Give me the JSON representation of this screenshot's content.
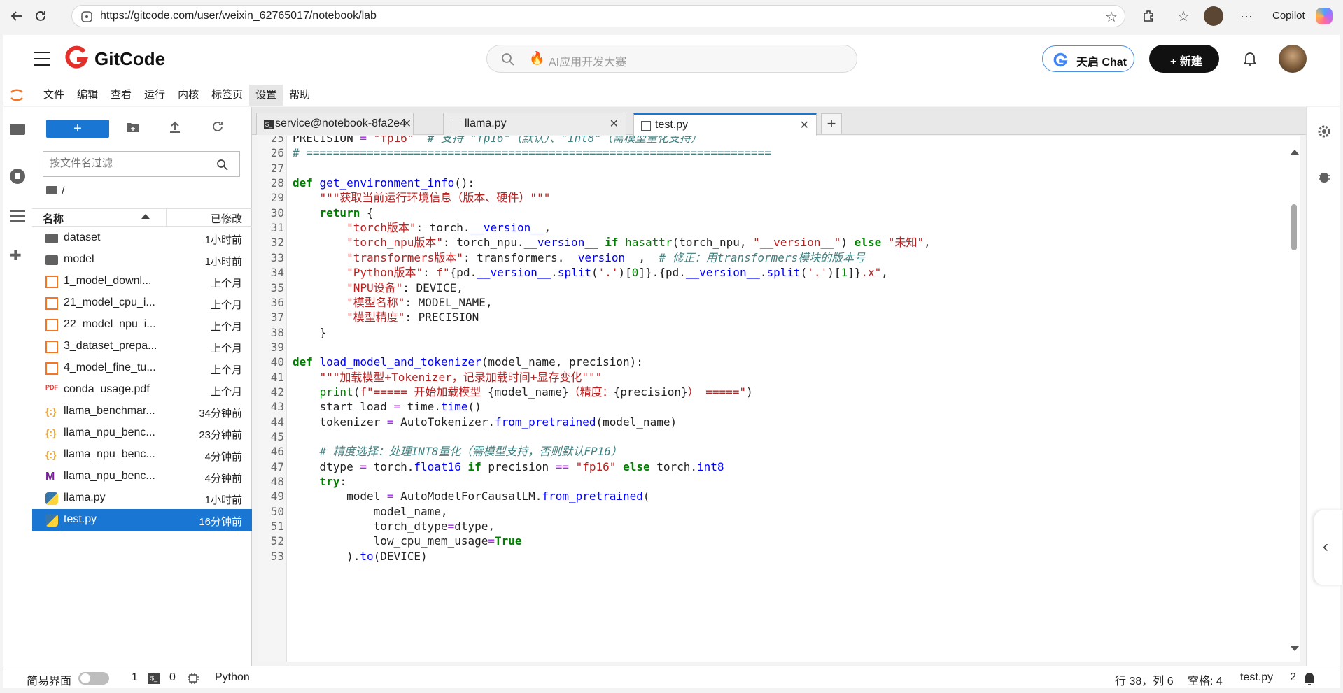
{
  "browser": {
    "url": "https://gitcode.com/user/weixin_62765017/notebook/lab",
    "copilot_label": "Copilot"
  },
  "site": {
    "logo_text": "GitCode",
    "search_placeholder": "AI应用开发大赛",
    "tianqi_label": "天启 Chat",
    "new_label": "+ 新建"
  },
  "menubar": {
    "items": [
      "文件",
      "编辑",
      "查看",
      "运行",
      "内核",
      "标签页",
      "设置",
      "帮助"
    ],
    "active_index": 6
  },
  "filebrowser": {
    "new_label": "+",
    "filter_placeholder": "按文件名过滤",
    "breadcrumb": "/",
    "col_name": "名称",
    "col_modified": "已修改",
    "files": [
      {
        "name": "dataset",
        "modified": "1小时前",
        "icon": "folder-icon",
        "selected": false
      },
      {
        "name": "model",
        "modified": "1小时前",
        "icon": "folder-icon",
        "selected": false
      },
      {
        "name": "1_model_downl...",
        "modified": "上个月",
        "icon": "notebook-icon",
        "selected": false
      },
      {
        "name": "21_model_cpu_i...",
        "modified": "上个月",
        "icon": "notebook-icon",
        "selected": false
      },
      {
        "name": "22_model_npu_i...",
        "modified": "上个月",
        "icon": "notebook-icon",
        "selected": false
      },
      {
        "name": "3_dataset_prepa...",
        "modified": "上个月",
        "icon": "notebook-icon",
        "selected": false
      },
      {
        "name": "4_model_fine_tu...",
        "modified": "上个月",
        "icon": "notebook-icon",
        "selected": false
      },
      {
        "name": "conda_usage.pdf",
        "modified": "上个月",
        "icon": "pdf-icon",
        "selected": false
      },
      {
        "name": "llama_benchmar...",
        "modified": "34分钟前",
        "icon": "json-icon",
        "selected": false
      },
      {
        "name": "llama_npu_benc...",
        "modified": "23分钟前",
        "icon": "json-icon",
        "selected": false
      },
      {
        "name": "llama_npu_benc...",
        "modified": "4分钟前",
        "icon": "json-icon",
        "selected": false
      },
      {
        "name": "llama_npu_benc...",
        "modified": "4分钟前",
        "icon": "markdown-icon",
        "selected": false
      },
      {
        "name": "llama.py",
        "modified": "1小时前",
        "icon": "python-icon",
        "selected": false
      },
      {
        "name": "test.py",
        "modified": "16分钟前",
        "icon": "python-icon",
        "selected": true
      }
    ]
  },
  "tabs": [
    {
      "label": "service@notebook-8fa2e4",
      "icon": "terminal-icon",
      "active": false
    },
    {
      "label": "llama.py",
      "icon": "file-icon",
      "active": false
    },
    {
      "label": "test.py",
      "icon": "file-icon",
      "active": true
    }
  ],
  "editor": {
    "lines": [
      {
        "n": "25",
        "html": "PRECISION <span class='op'>=</span> <span class='str'>\"fp16\"</span>  <span class='cmt'># 支持 \"fp16\"（默认）、\"int8\"（需模型量化支持）</span>"
      },
      {
        "n": "26",
        "html": "<span class='cmt'># =====================================================================</span>"
      },
      {
        "n": "27",
        "html": ""
      },
      {
        "n": "28",
        "html": "<span class='kw'>def</span> <span class='fn'>get_environment_info</span>():"
      },
      {
        "n": "29",
        "html": "    <span class='str'>\"\"\"获取当前运行环境信息（版本、硬件）\"\"\"</span>"
      },
      {
        "n": "30",
        "html": "    <span class='kw'>return</span> {"
      },
      {
        "n": "31",
        "html": "        <span class='str'>\"torch版本\"</span>: torch.<span class='fn'>__version__</span>,"
      },
      {
        "n": "32",
        "html": "        <span class='str'>\"torch_npu版本\"</span>: torch_npu.<span class='fn'>__version__</span> <span class='kw'>if</span> <span class='bi'>hasattr</span>(torch_npu, <span class='str'>\"__version__\"</span>) <span class='kw'>else</span> <span class='str'>\"未知\"</span>,"
      },
      {
        "n": "33",
        "html": "        <span class='str'>\"transformers版本\"</span>: transformers.<span class='fn'>__version__</span>,  <span class='cmt'># 修正：用transformers模块的版本号</span>"
      },
      {
        "n": "34",
        "html": "        <span class='str'>\"Python版本\"</span>: <span class='str'>f\"</span>{pd.<span class='fn'>__version__</span>.<span class='fn'>split</span>(<span class='str'>'.'</span>)[<span class='num'>0</span>]}.{pd.<span class='fn'>__version__</span>.<span class='fn'>split</span>(<span class='str'>'.'</span>)[<span class='num'>1</span>]}<span class='str'>.x\"</span>,"
      },
      {
        "n": "35",
        "html": "        <span class='str'>\"NPU设备\"</span>: DEVICE,"
      },
      {
        "n": "36",
        "html": "        <span class='str'>\"模型名称\"</span>: MODEL_NAME,"
      },
      {
        "n": "37",
        "html": "        <span class='str'>\"模型精度\"</span>: PRECISION"
      },
      {
        "n": "38",
        "html": "    }"
      },
      {
        "n": "39",
        "html": ""
      },
      {
        "n": "40",
        "html": "<span class='kw'>def</span> <span class='fn'>load_model_and_tokenizer</span>(model_name, precision):"
      },
      {
        "n": "41",
        "html": "    <span class='str'>\"\"\"加载模型+Tokenizer，记录加载时间+显存变化\"\"\"</span>"
      },
      {
        "n": "42",
        "html": "    <span class='bi'>print</span>(<span class='str'>f\"===== 开始加载模型 </span>{model_name}<span class='str'>（精度：</span>{precision}<span class='str'>） =====\"</span>)"
      },
      {
        "n": "43",
        "html": "    start_load <span class='op'>=</span> time.<span class='fn'>time</span>()"
      },
      {
        "n": "44",
        "html": "    tokenizer <span class='op'>=</span> AutoTokenizer.<span class='fn'>from_pretrained</span>(model_name)"
      },
      {
        "n": "45",
        "html": ""
      },
      {
        "n": "46",
        "html": "    <span class='cmt'># 精度选择：处理INT8量化（需模型支持，否则默认FP16）</span>"
      },
      {
        "n": "47",
        "html": "    dtype <span class='op'>=</span> torch.<span class='fn'>float16</span> <span class='kw'>if</span> precision <span class='op'>==</span> <span class='str'>\"fp16\"</span> <span class='kw'>else</span> torch.<span class='fn'>int8</span>"
      },
      {
        "n": "48",
        "html": "    <span class='kw'>try</span>:"
      },
      {
        "n": "49",
        "html": "        model <span class='op'>=</span> AutoModelForCausalLM.<span class='fn'>from_pretrained</span>("
      },
      {
        "n": "50",
        "html": "            model_name,"
      },
      {
        "n": "51",
        "html": "            torch_dtype<span class='op'>=</span>dtype,"
      },
      {
        "n": "52",
        "html": "            low_cpu_mem_usage<span class='op'>=</span><span class='kw'>True</span>"
      },
      {
        "n": "53",
        "html": "        ).<span class='fn'>to</span>(DEVICE)"
      }
    ]
  },
  "statusbar": {
    "simple_mode": "简易界面",
    "terminals": "1",
    "kernels": "0",
    "kernel_name": "Python",
    "cursor": "行 38，列 6",
    "spaces": "空格: 4",
    "filename": "test.py",
    "notifications": "2"
  },
  "colors": {
    "accent": "#1976d2",
    "gitcode_red": "#e4302b"
  }
}
